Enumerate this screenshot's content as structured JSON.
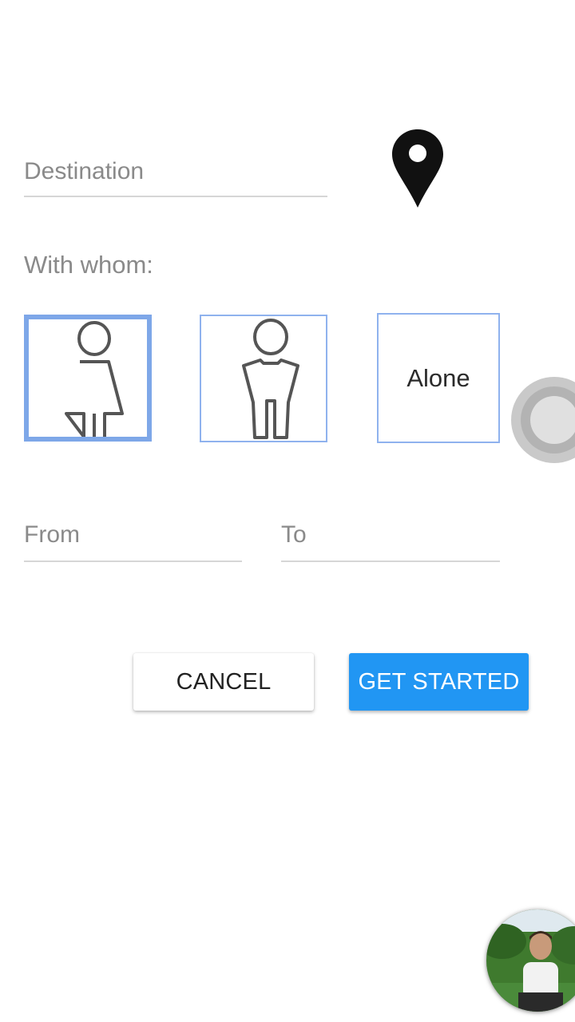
{
  "form": {
    "destination_placeholder": "Destination",
    "with_whom_label": "With whom:",
    "from_placeholder": "From",
    "to_placeholder": "To"
  },
  "companions": {
    "selected": "female",
    "options": [
      {
        "id": "female",
        "icon": "female-person-icon"
      },
      {
        "id": "male",
        "icon": "male-person-icon"
      },
      {
        "id": "alone",
        "label": "Alone"
      }
    ]
  },
  "actions": {
    "cancel_label": "CANCEL",
    "get_started_label": "GET STARTED"
  },
  "colors": {
    "accent": "#2196f3",
    "selection_border": "#7ea7e8"
  },
  "icons": {
    "location": "location-pin-icon",
    "assistive": "assistive-touch-icon",
    "avatar": "chat-head-avatar"
  }
}
